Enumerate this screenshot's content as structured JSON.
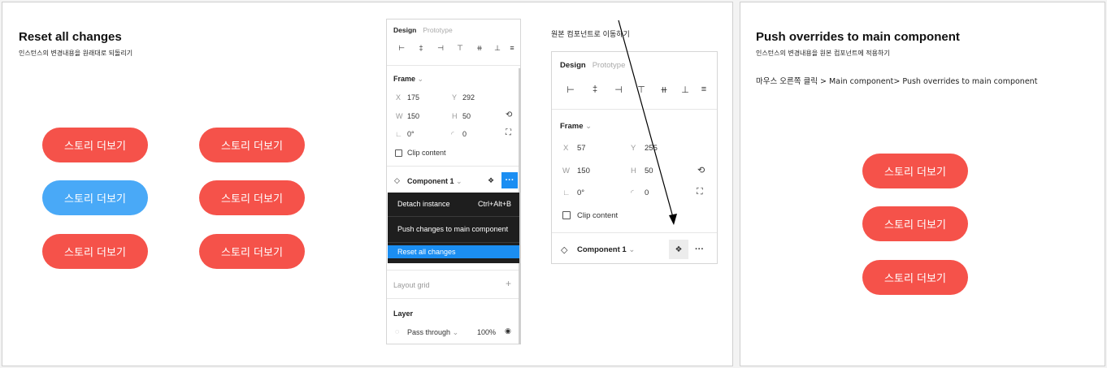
{
  "left": {
    "title": "Reset all changes",
    "subtitle": "인스턴스의 변경내용을 원래대로 되돌리기",
    "buttons": [
      "스토리 더보기",
      "스토리 더보기",
      "스토리 더보기",
      "스토리 더보기",
      "스토리 더보기",
      "스토리 더보기"
    ],
    "panel": {
      "tab_design": "Design",
      "tab_prototype": "Prototype",
      "frame_label": "Frame",
      "x_label": "X",
      "x_value": "175",
      "y_label": "Y",
      "y_value": "292",
      "w_label": "W",
      "w_value": "150",
      "h_label": "H",
      "h_value": "50",
      "rotation_value": "0°",
      "radius_value": "0",
      "clip_content": "Clip content",
      "component_name": "Component 1",
      "layout_grid": "Layout grid",
      "layer": "Layer",
      "blend_mode": "Pass through",
      "opacity": "100%"
    },
    "menu": {
      "detach": "Detach instance",
      "detach_shortcut": "Ctrl+Alt+B",
      "push": "Push changes to main component",
      "reset": "Reset all changes"
    }
  },
  "middle": {
    "caption": "원본 컴포넌트로 이동하기",
    "panel": {
      "tab_design": "Design",
      "tab_prototype": "Prototype",
      "frame_label": "Frame",
      "x_label": "X",
      "x_value": "57",
      "y_label": "Y",
      "y_value": "255",
      "w_label": "W",
      "w_value": "150",
      "h_label": "H",
      "h_value": "50",
      "rotation_value": "0°",
      "radius_value": "0",
      "clip_content": "Clip content",
      "component_name": "Component 1"
    }
  },
  "right": {
    "title": "Push overrides to main component",
    "subtitle": "인스턴스의 변경내용을 원본 컴포넌트에 적용하기",
    "instruction": "마우스 오른쪽 클릭 > Main component> Push overrides to main component",
    "buttons": [
      "스토리 더보기",
      "스토리 더보기",
      "스토리 더보기"
    ]
  },
  "colors": {
    "pill_red": "#f5524a",
    "pill_blue": "#49a9f7",
    "accent": "#1b8ef2",
    "menu_bg": "#1e1e1e"
  }
}
